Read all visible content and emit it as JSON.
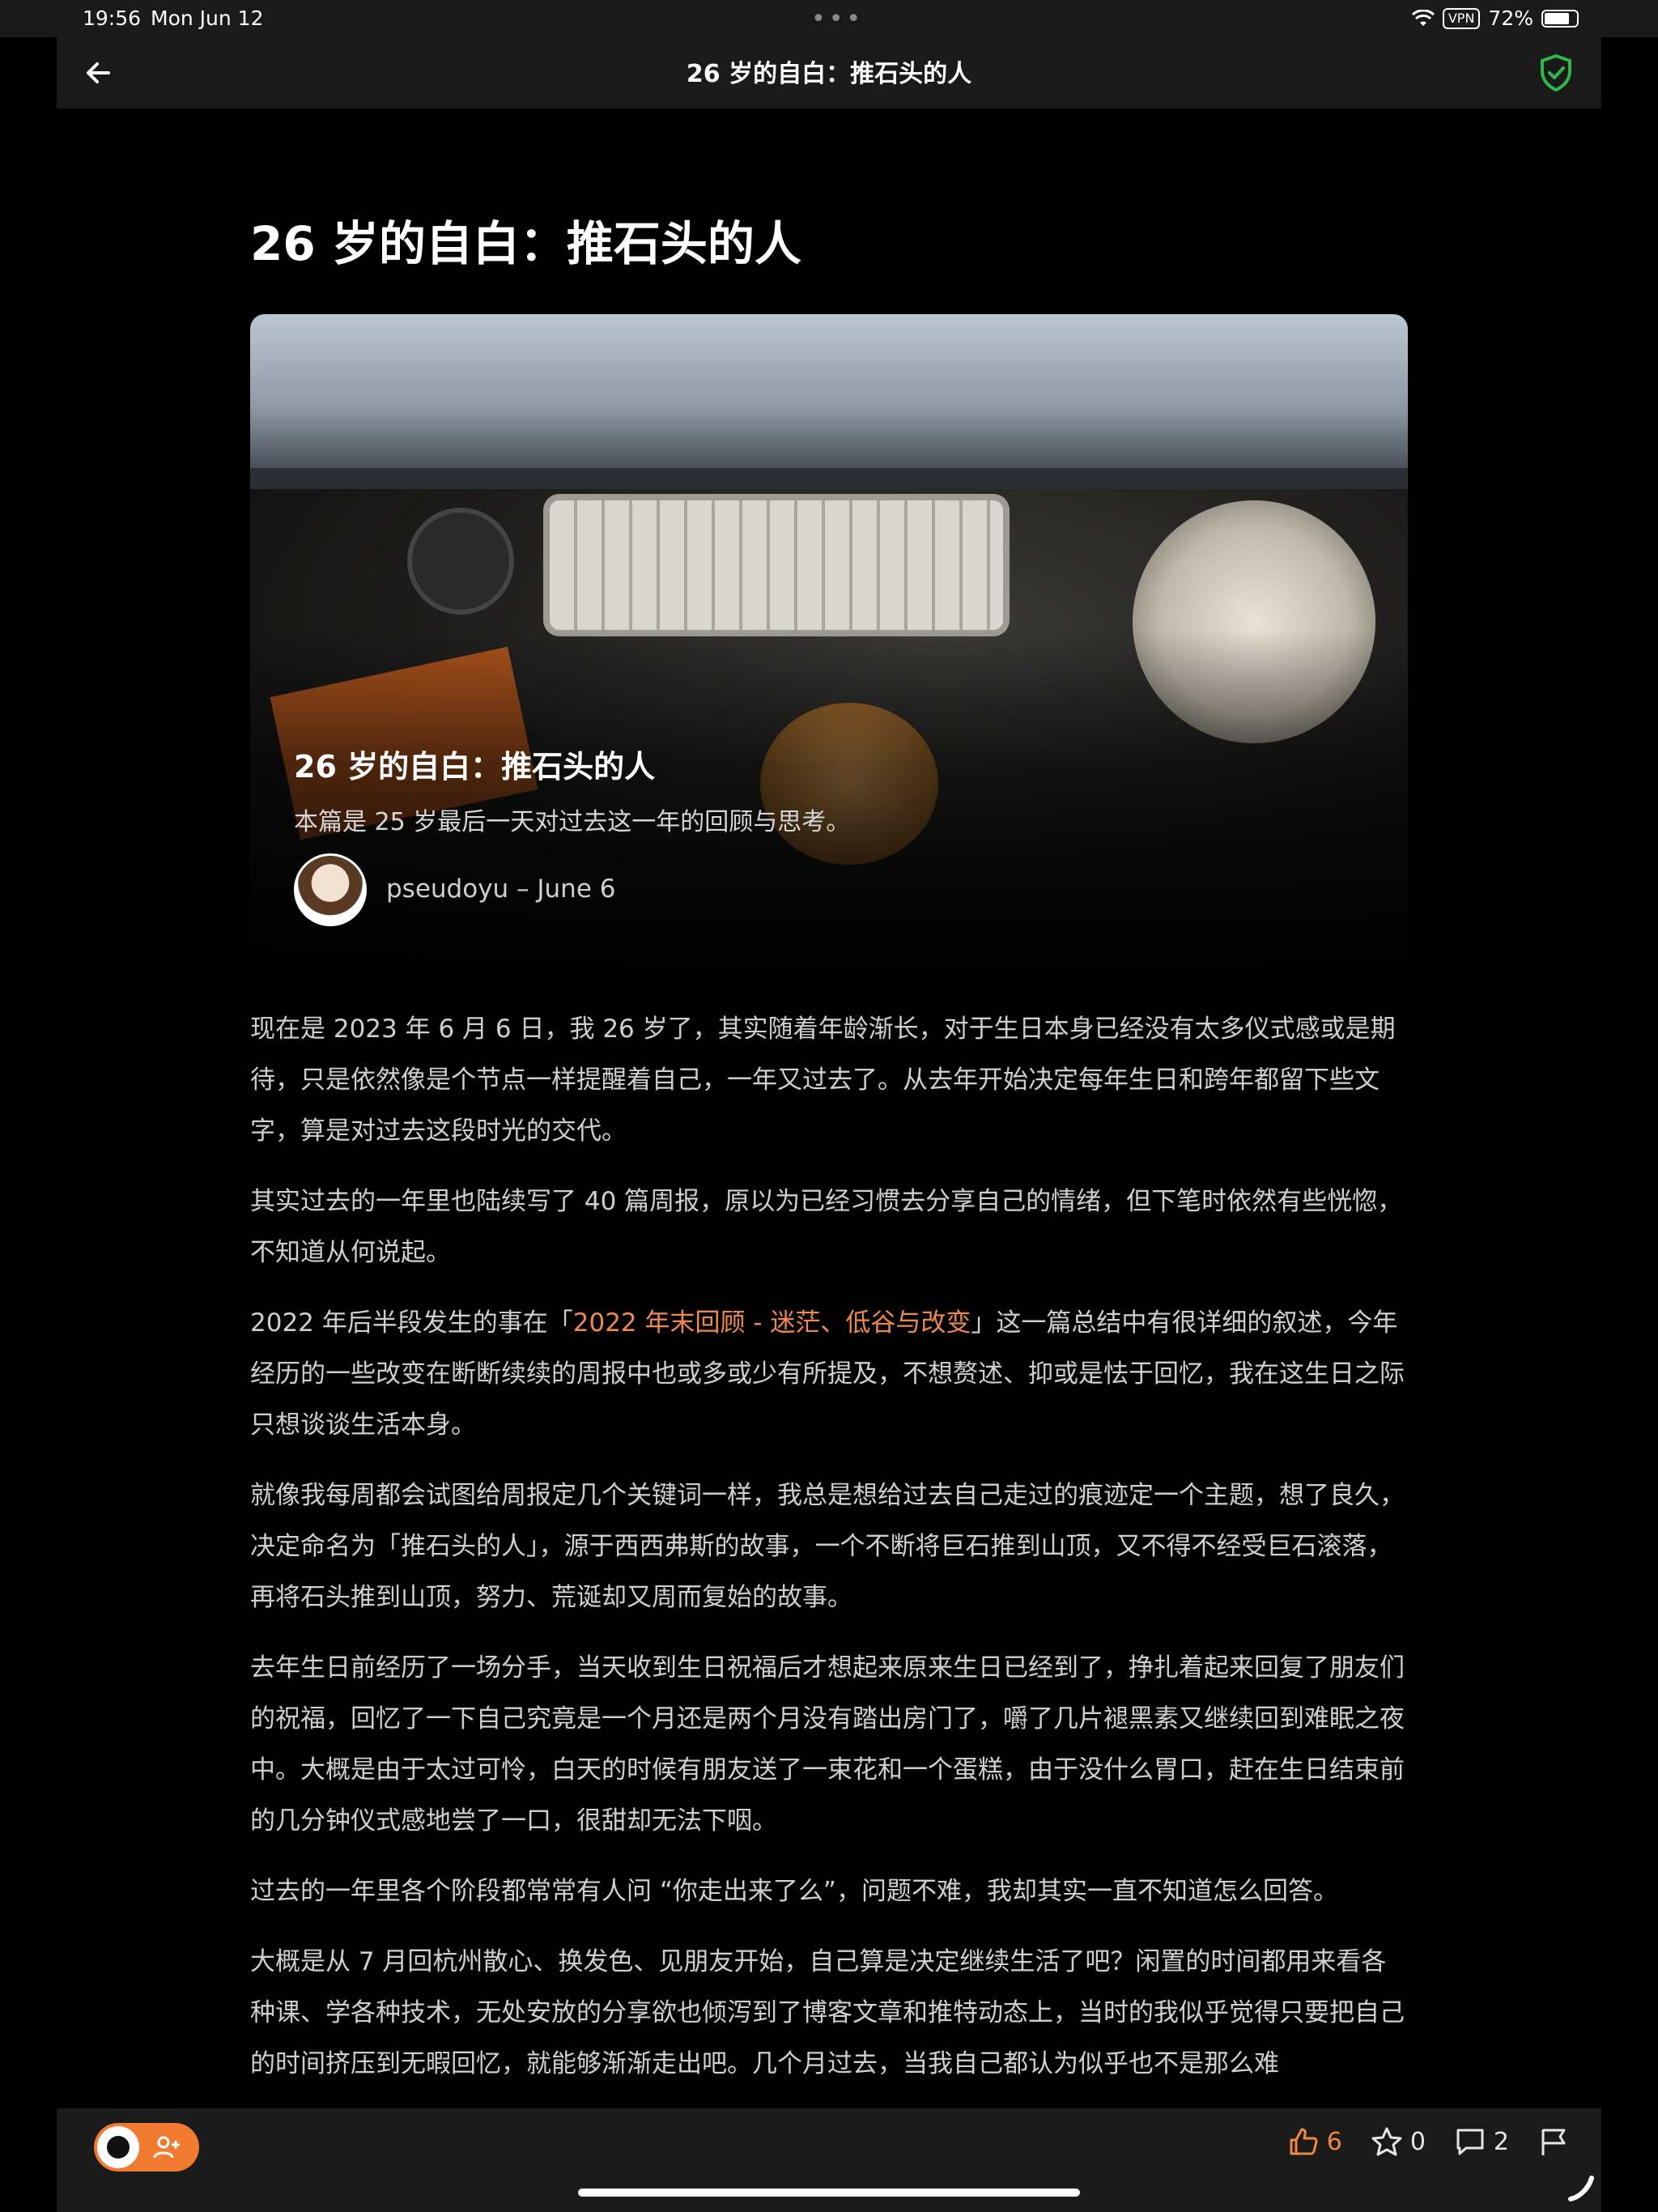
{
  "status_bar": {
    "time": "19:56",
    "date": "Mon Jun 12",
    "vpn": "VPN",
    "battery": "72%"
  },
  "nav": {
    "title": "26 岁的自白：推石头的人"
  },
  "article": {
    "title": "26 岁的自白：推石头的人",
    "hero": {
      "title": "26 岁的自白：推石头的人",
      "description": "本篇是 25 岁最后一天对过去这一年的回顾与思考。",
      "author_line": "pseudoyu – June 6"
    },
    "paragraphs": [
      "现在是 2023 年 6 月 6 日，我 26 岁了，其实随着年龄渐长，对于生日本身已经没有太多仪式感或是期待，只是依然像是个节点一样提醒着自己，一年又过去了。从去年开始决定每年生日和跨年都留下些文字，算是对过去这段时光的交代。",
      "其实过去的一年里也陆续写了 40 篇周报，原以为已经习惯去分享自己的情绪，但下笔时依然有些恍惚，不知道从何说起。",
      "就像我每周都会试图给周报定几个关键词一样，我总是想给过去自己走过的痕迹定一个主题，想了良久，决定命名为「推石头的人」，源于西西弗斯的故事，一个不断将巨石推到山顶，又不得不经受巨石滚落，再将石头推到山顶，努力、荒诞却又周而复始的故事。",
      "去年生日前经历了一场分手，当天收到生日祝福后才想起来原来生日已经到了，挣扎着起来回复了朋友们的祝福，回忆了一下自己究竟是一个月还是两个月没有踏出房门了，嚼了几片褪黑素又继续回到难眠之夜中。大概是由于太过可怜，白天的时候有朋友送了一束花和一个蛋糕，由于没什么胃口，赶在生日结束前的几分钟仪式感地尝了一口，很甜却无法下咽。",
      "过去的一年里各个阶段都常常有人问 “你走出来了么”，问题不难，我却其实一直不知道怎么回答。",
      "大概是从 7 月回杭州散心、换发色、见朋友开始，自己算是决定继续生活了吧？闲置的时间都用来看各种课、学各种技术，无处安放的分享欲也倾泻到了博客文章和推特动态上，当时的我似乎觉得只要把自己的时间挤压到无暇回忆，就能够渐渐走出吧。几个月过去，当我自己都认为似乎也不是那么难"
    ],
    "p3": {
      "before": "2022 年后半段发生的事在「",
      "link": "2022 年末回顾 - 迷茫、低谷与改变",
      "after": "」这一篇总结中有很详细的叙述，今年经历的一些改变在断断续续的周报中也或多或少有所提及，不想赘述、抑或是怯于回忆，我在这生日之际只想谈谈生活本身。"
    }
  },
  "bottom_bar": {
    "likes": "6",
    "stars": "0",
    "comments": "2"
  },
  "colors": {
    "accent": "#f07a30",
    "link": "#f08a4b",
    "shield": "#2db84d",
    "background": "#000000",
    "bar": "#1a1a1a"
  },
  "icons": [
    "back-arrow-icon",
    "shield-check-icon",
    "wifi-icon",
    "battery-icon",
    "thumbs-up-icon",
    "star-icon",
    "comment-icon",
    "flag-icon",
    "add-user-icon"
  ]
}
